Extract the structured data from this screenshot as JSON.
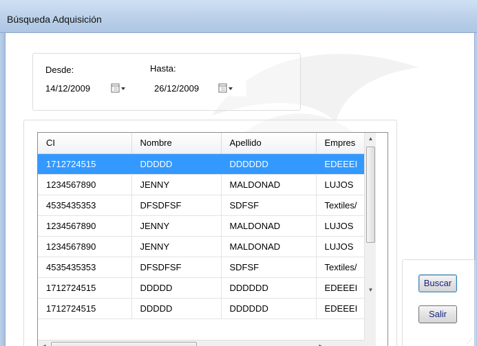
{
  "window": {
    "title": "Búsqueda Adquisición"
  },
  "filters": {
    "desde_label": "Desde:",
    "desde_value": "14/12/2009",
    "hasta_label": "Hasta:",
    "hasta_value": "26/12/2009"
  },
  "grid": {
    "columns": [
      "CI",
      "Nombre",
      "Apellido",
      "Empres"
    ],
    "rows": [
      [
        "1712724515",
        "DDDDD",
        "DDDDDD",
        "EDEEEI"
      ],
      [
        "1234567890",
        "JENNY",
        "MALDONAD",
        "LUJOS"
      ],
      [
        "4535435353",
        "DFSDFSF",
        "SDFSF",
        "Textiles/"
      ],
      [
        "1234567890",
        "JENNY",
        "MALDONAD",
        "LUJOS"
      ],
      [
        "1234567890",
        "JENNY",
        "MALDONAD",
        "LUJOS"
      ],
      [
        "4535435353",
        "DFSDFSF",
        "SDFSF",
        "Textiles/"
      ],
      [
        "1712724515",
        "DDDDD",
        "DDDDDD",
        "EDEEEI"
      ],
      [
        "1712724515",
        "DDDDD",
        "DDDDDD",
        "EDEEEI"
      ]
    ],
    "selected_row": 0
  },
  "buttons": {
    "buscar": "Buscar",
    "salir": "Salir"
  },
  "icons": {
    "calendar": "calendar-icon",
    "dropdown": "chevron-down-icon",
    "scroll_up": "scroll-up-arrow-icon",
    "scroll_down": "scroll-down-arrow-icon",
    "scroll_left": "scroll-left-arrow-icon",
    "scroll_right": "scroll-right-arrow-icon"
  },
  "colors": {
    "selection": "#3399ff",
    "button_text": "#1a237e",
    "titlebar": "#b9cfe9"
  }
}
